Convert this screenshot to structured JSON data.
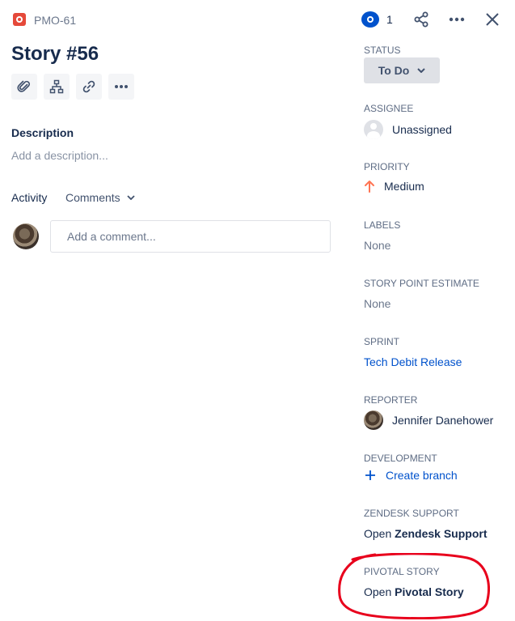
{
  "header": {
    "issue_key": "PMO-61",
    "issue_type_icon": "bug-icon",
    "watchers_count": "1"
  },
  "issue": {
    "title": "Story #56"
  },
  "description": {
    "heading": "Description",
    "placeholder": "Add a description..."
  },
  "activity": {
    "label": "Activity",
    "filter": "Comments",
    "comment_placeholder": "Add a comment..."
  },
  "fields": {
    "status": {
      "label": "STATUS",
      "value": "To Do"
    },
    "assignee": {
      "label": "ASSIGNEE",
      "value": "Unassigned"
    },
    "priority": {
      "label": "PRIORITY",
      "value": "Medium",
      "color": "#ff7452"
    },
    "labels": {
      "label": "LABELS",
      "value": "None"
    },
    "story_points": {
      "label": "STORY POINT ESTIMATE",
      "value": "None"
    },
    "sprint": {
      "label": "SPRINT",
      "value": "Tech Debit Release"
    },
    "reporter": {
      "label": "REPORTER",
      "value": "Jennifer Danehower"
    },
    "development": {
      "label": "DEVELOPMENT",
      "action": "Create branch"
    },
    "zendesk": {
      "label": "ZENDESK SUPPORT",
      "prefix": "Open",
      "name": "Zendesk Support"
    },
    "pivotal": {
      "label": "PIVOTAL STORY",
      "prefix": "Open",
      "name": "Pivotal Story"
    }
  },
  "colors": {
    "accent": "#0052cc",
    "annotation": "#e8001c"
  }
}
